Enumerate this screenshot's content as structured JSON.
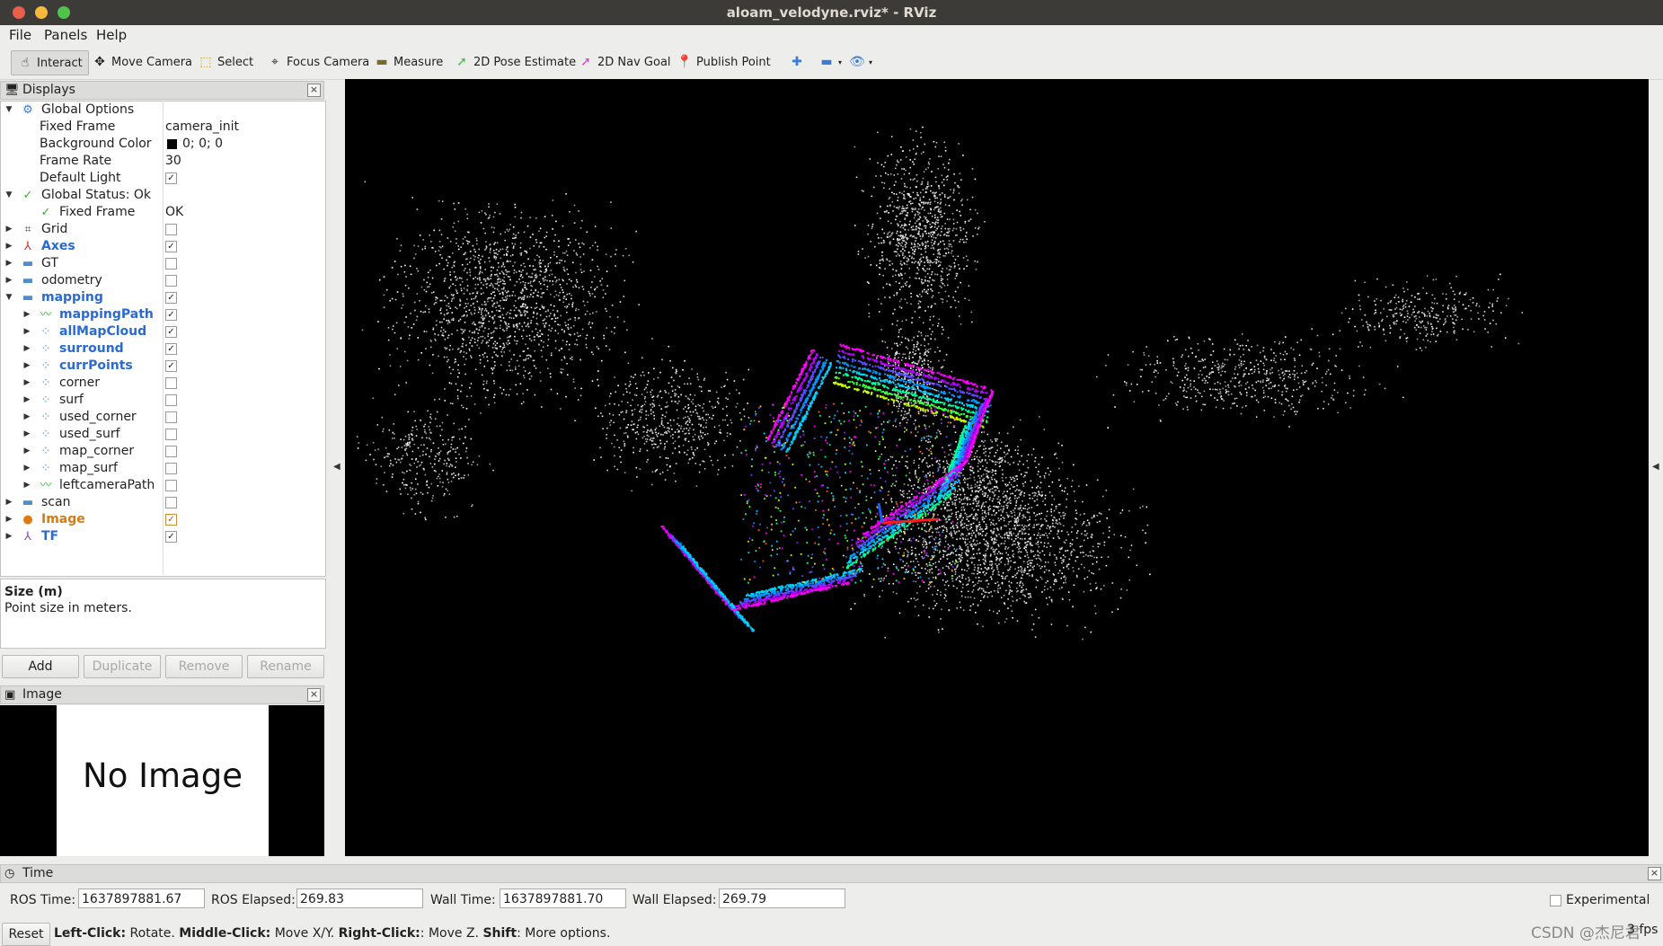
{
  "window": {
    "title": "aloam_velodyne.rviz* - RViz",
    "close_color": "#e95f4c",
    "minimize_color": "#f5b93c",
    "maximize_color": "#4fc34b"
  },
  "menubar": {
    "file": "File",
    "panels": "Panels",
    "help": "Help"
  },
  "toolbar": {
    "interact": "Interact",
    "move_camera": "Move Camera",
    "select": "Select",
    "focus_camera": "Focus Camera",
    "measure": "Measure",
    "pose_estimate": "2D Pose Estimate",
    "nav_goal": "2D Nav Goal",
    "publish_point": "Publish Point"
  },
  "displays": {
    "header": "Displays",
    "rows": [
      {
        "name": "Global Options"
      },
      {
        "name": "Fixed Frame",
        "value": "camera_init"
      },
      {
        "name": "Background Color",
        "value": "0; 0; 0"
      },
      {
        "name": "Frame Rate",
        "value": "30"
      },
      {
        "name": "Default Light",
        "checked": true
      },
      {
        "name": "Global Status: Ok"
      },
      {
        "name": "Fixed Frame",
        "value": "OK"
      },
      {
        "name": "Grid",
        "checked": false
      },
      {
        "name": "Axes",
        "checked": true
      },
      {
        "name": "GT",
        "checked": false
      },
      {
        "name": "odometry",
        "checked": false
      },
      {
        "name": "mapping",
        "checked": true
      },
      {
        "name": "mappingPath",
        "checked": true
      },
      {
        "name": "allMapCloud",
        "checked": true
      },
      {
        "name": "surround",
        "checked": true
      },
      {
        "name": "currPoints",
        "checked": true
      },
      {
        "name": "corner",
        "checked": false
      },
      {
        "name": "surf",
        "checked": false
      },
      {
        "name": "used_corner",
        "checked": false
      },
      {
        "name": "used_surf",
        "checked": false
      },
      {
        "name": "map_corner",
        "checked": false
      },
      {
        "name": "map_surf",
        "checked": false
      },
      {
        "name": "leftcameraPath",
        "checked": false
      },
      {
        "name": "scan",
        "checked": false
      },
      {
        "name": "Image",
        "checked": true
      },
      {
        "name": "TF",
        "checked": true
      }
    ],
    "description_title": "Size (m)",
    "description_text": "Point size in meters.",
    "buttons": {
      "add": "Add",
      "duplicate": "Duplicate",
      "remove": "Remove",
      "rename": "Rename"
    }
  },
  "image_panel": {
    "header": "Image",
    "placeholder": "No Image"
  },
  "time_panel": {
    "header": "Time",
    "ros_time_label": "ROS Time:",
    "ros_time": "1637897881.67",
    "ros_elapsed_label": "ROS Elapsed:",
    "ros_elapsed": "269.83",
    "wall_time_label": "Wall Time:",
    "wall_time": "1637897881.70",
    "wall_elapsed_label": "Wall Elapsed:",
    "wall_elapsed": "269.79",
    "experimental": "Experimental"
  },
  "status": {
    "reset": "Reset",
    "left_click": "Left-Click:",
    "left_click_desc": " Rotate. ",
    "middle_click": "Middle-Click:",
    "middle_click_desc": " Move X/Y. ",
    "right_click": "Right-Click:",
    "right_click_desc": ": Move Z. ",
    "shift": "Shift",
    "shift_desc": ": More options.",
    "fps": "3 fps",
    "watermark": "CSDN @杰尼君"
  },
  "colors": {
    "viewport_bg": "#000000",
    "link_blue": "#2a6bd1",
    "warn_orange": "#d67a14"
  }
}
